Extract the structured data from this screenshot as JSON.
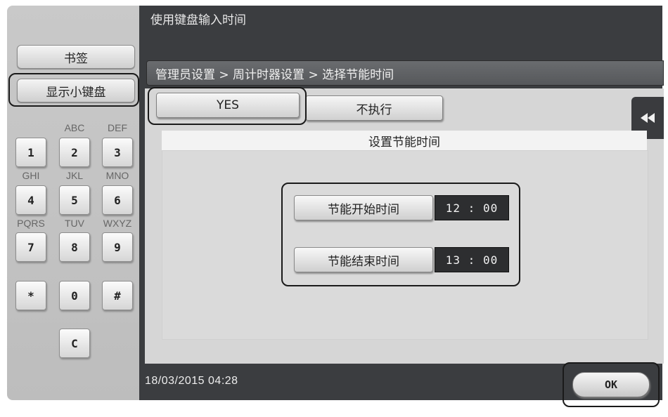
{
  "window": {
    "title": "使用键盘输入时间"
  },
  "sidebar": {
    "bookmark_label": "书签",
    "show_keypad_label": "显示小键盘"
  },
  "keypad": {
    "letters": {
      "k2": "ABC",
      "k3": "DEF",
      "k4": "GHI",
      "k5": "JKL",
      "k6": "MNO",
      "k7": "PQRS",
      "k8": "TUV",
      "k9": "WXYZ"
    },
    "keys": {
      "k1": "1",
      "k2": "2",
      "k3": "3",
      "k4": "4",
      "k5": "5",
      "k6": "6",
      "k7": "7",
      "k8": "8",
      "k9": "9",
      "star": "*",
      "k0": "0",
      "hash": "#",
      "clear": "C"
    }
  },
  "breadcrumb": {
    "text": "管理员设置 > 周计时器设置 > 选择节能时间"
  },
  "tabs": {
    "yes_label": "YES",
    "no_label": "不执行",
    "selected": "YES"
  },
  "panel": {
    "header": "设置节能时间",
    "start_label": "节能开始时间",
    "start_value": "12 : 00",
    "end_label": "节能结束时间",
    "end_value": "13 : 00"
  },
  "collapse_icon": "double-chevron-left-icon",
  "status": {
    "datetime": "18/03/2015  04:28"
  },
  "ok_label": "OK"
}
